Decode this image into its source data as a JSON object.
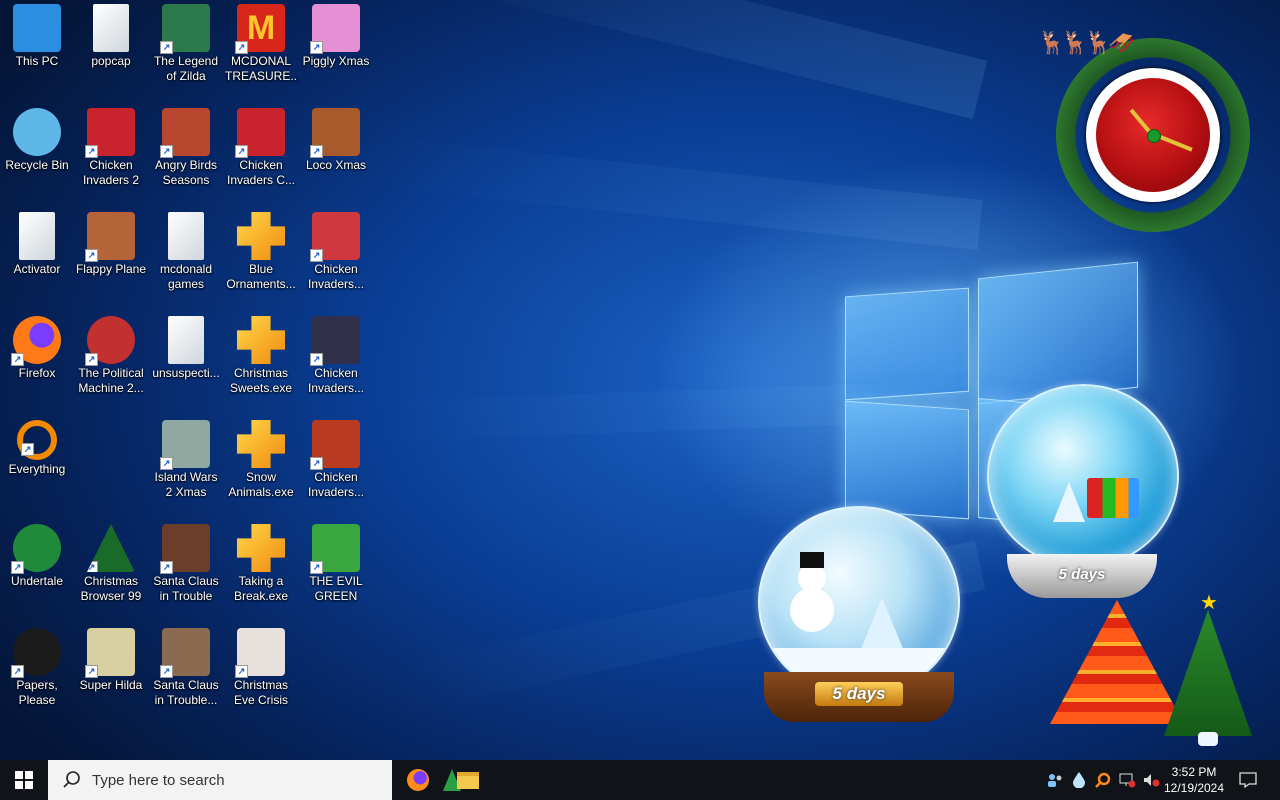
{
  "desktop": {
    "icons": [
      {
        "label": "This PC",
        "icon": "pc-icon",
        "color": "#2a8fe0"
      },
      {
        "label": "Recycle Bin",
        "icon": "recycle-bin-icon",
        "color": "#5fb6e8"
      },
      {
        "label": "Activator",
        "icon": "file-icon",
        "color": "#e8e8e8"
      },
      {
        "label": "Firefox",
        "icon": "firefox-icon",
        "color": "#ff7a17"
      },
      {
        "label": "Everything",
        "icon": "everything-icon",
        "color": "#f28a00"
      },
      {
        "label": "Undertale",
        "icon": "undertale-icon",
        "color": "#1f8a3a"
      },
      {
        "label": "Papers, Please",
        "icon": "papers-please-icon",
        "color": "#1b1b1b"
      },
      {
        "label": "popcap",
        "icon": "folder-icon",
        "color": "#e0e0e0"
      },
      {
        "label": "Chicken Invaders 2",
        "icon": "chicken-invaders-icon",
        "color": "#c9242d"
      },
      {
        "label": "Flappy Plane",
        "icon": "flappy-plane-icon",
        "color": "#b5643a"
      },
      {
        "label": "The Political Machine 2...",
        "icon": "political-machine-icon",
        "color": "#c23030"
      },
      {
        "label": "Christmas Browser 99",
        "icon": "christmas-tree-icon",
        "color": "#1a6b2a"
      },
      {
        "label": "Super Hilda",
        "icon": "super-hilda-icon",
        "color": "#d8d0a0"
      },
      {
        "label": "The Legend of Zilda",
        "icon": "zilda-icon",
        "color": "#2c7a4b"
      },
      {
        "label": "Angry Birds Seasons",
        "icon": "angry-birds-icon",
        "color": "#b9462f"
      },
      {
        "label": "mcdonald games",
        "icon": "folder-icon",
        "color": "#e0e0e0"
      },
      {
        "label": "unsuspecti...",
        "icon": "folder-icon",
        "color": "#e0e0e0"
      },
      {
        "label": "Island Wars 2 Xmas",
        "icon": "island-wars-icon",
        "color": "#8fa8a0"
      },
      {
        "label": "Santa Claus in Trouble",
        "icon": "santa-icon",
        "color": "#6b3d2b"
      },
      {
        "label": "Santa Claus in Trouble...",
        "icon": "santa-icon",
        "color": "#8a6a50"
      },
      {
        "label": "MCDONAL TREASURE...",
        "icon": "mcdonalds-icon",
        "color": "#d8261b"
      },
      {
        "label": "Chicken Invaders C...",
        "icon": "chicken-invaders-icon",
        "color": "#c9242d"
      },
      {
        "label": "Blue Ornaments...",
        "icon": "popcap-puzzle-icon",
        "color": "#f5a623"
      },
      {
        "label": "Christmas Sweets.exe",
        "icon": "popcap-puzzle-icon",
        "color": "#f5a623"
      },
      {
        "label": "Snow Animals.exe",
        "icon": "popcap-puzzle-icon",
        "color": "#f5a623"
      },
      {
        "label": "Taking a Break.exe",
        "icon": "popcap-puzzle-icon",
        "color": "#f5a623"
      },
      {
        "label": "Christmas Eve Crisis",
        "icon": "santa-face-icon",
        "color": "#e8e0dc"
      },
      {
        "label": "Piggly Xmas",
        "icon": "piggly-icon",
        "color": "#e58fd4"
      },
      {
        "label": "Loco Xmas",
        "icon": "loco-icon",
        "color": "#a85a2a"
      },
      {
        "label": "Chicken Invaders...",
        "icon": "chicken-invaders-icon",
        "color": "#d03840"
      },
      {
        "label": "Chicken Invaders...",
        "icon": "chicken-invaders-icon",
        "color": "#30304a"
      },
      {
        "label": "Chicken Invaders...",
        "icon": "chicken-invaders-icon",
        "color": "#b83a20"
      },
      {
        "label": "THE EVIL GREEN ME...",
        "icon": "messenger-icon",
        "color": "#3aa640"
      }
    ]
  },
  "gadgets": {
    "globe_left_label": "5 days",
    "globe_right_label": "5 days"
  },
  "taskbar": {
    "search_placeholder": "Type here to search",
    "pinned": [
      "firefox-icon",
      "tree-icon",
      "file-explorer-icon"
    ],
    "time": "3:52 PM",
    "date": "12/19/2024"
  }
}
